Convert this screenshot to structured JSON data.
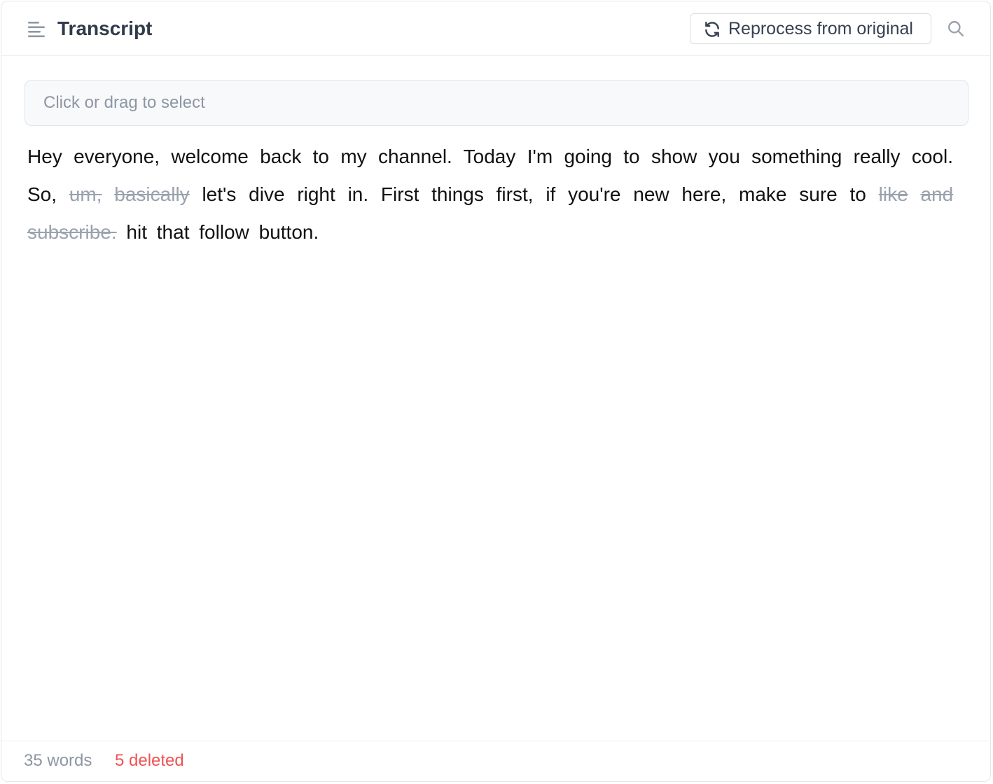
{
  "header": {
    "title": "Transcript",
    "menu_icon": "menu-lines-icon",
    "reprocess_label": "Reprocess from original",
    "reprocess_icon": "refresh-icon",
    "search_icon": "search-icon"
  },
  "selector": {
    "placeholder": "Click or drag to select"
  },
  "transcript": {
    "words": [
      {
        "text": "Hey",
        "deleted": false
      },
      {
        "text": "everyone,",
        "deleted": false
      },
      {
        "text": "welcome",
        "deleted": false
      },
      {
        "text": "back",
        "deleted": false
      },
      {
        "text": "to",
        "deleted": false
      },
      {
        "text": "my",
        "deleted": false
      },
      {
        "text": "channel.",
        "deleted": false
      },
      {
        "text": "Today",
        "deleted": false
      },
      {
        "text": "I'm",
        "deleted": false
      },
      {
        "text": "going",
        "deleted": false
      },
      {
        "text": "to",
        "deleted": false
      },
      {
        "text": "show",
        "deleted": false
      },
      {
        "text": "you",
        "deleted": false
      },
      {
        "text": "something",
        "deleted": false
      },
      {
        "text": "really",
        "deleted": false
      },
      {
        "text": "cool.",
        "deleted": false
      },
      {
        "text": "So,",
        "deleted": false
      },
      {
        "text": "um,",
        "deleted": true
      },
      {
        "text": "basically",
        "deleted": true
      },
      {
        "text": "let's",
        "deleted": false
      },
      {
        "text": "dive",
        "deleted": false
      },
      {
        "text": "right",
        "deleted": false
      },
      {
        "text": "in.",
        "deleted": false
      },
      {
        "text": "First",
        "deleted": false
      },
      {
        "text": "things",
        "deleted": false
      },
      {
        "text": "first,",
        "deleted": false
      },
      {
        "text": "if",
        "deleted": false
      },
      {
        "text": "you're",
        "deleted": false
      },
      {
        "text": "new",
        "deleted": false
      },
      {
        "text": "here,",
        "deleted": false
      },
      {
        "text": "make",
        "deleted": false
      },
      {
        "text": "sure",
        "deleted": false
      },
      {
        "text": "to",
        "deleted": false
      },
      {
        "text": "like",
        "deleted": true
      },
      {
        "text": "and",
        "deleted": true
      },
      {
        "text": "subscribe.",
        "deleted": true
      },
      {
        "text": "hit",
        "deleted": false
      },
      {
        "text": "that",
        "deleted": false
      },
      {
        "text": "follow",
        "deleted": false
      },
      {
        "text": "button.",
        "deleted": false
      }
    ]
  },
  "footer": {
    "word_count": "35 words",
    "deleted_count": "5 deleted"
  },
  "colors": {
    "deleted_word": "#9aa2ad",
    "deleted_count": "#f05252",
    "title": "#2f3a4b",
    "text": "#111111"
  }
}
